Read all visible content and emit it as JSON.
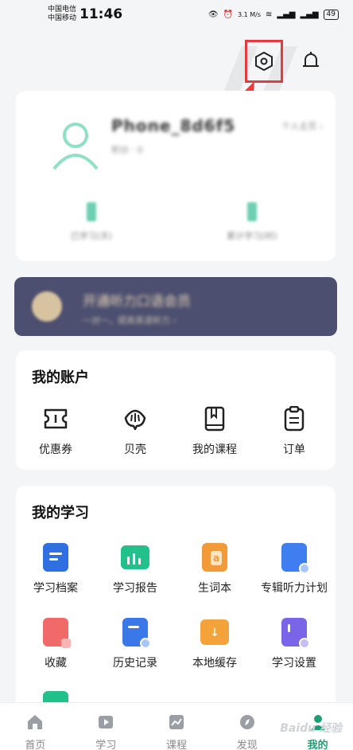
{
  "status_bar": {
    "carrier1": "中国电信",
    "carrier2": "中国移动",
    "time": "11:46",
    "speed": "3.1 M/s",
    "battery": "49"
  },
  "profile": {
    "username": "Phone_8d6f5",
    "subtitle": "积分 · 0",
    "tag": "个人主页 ›",
    "stats": [
      {
        "label": "已学习(天)"
      },
      {
        "label": "累计学习(时)"
      }
    ]
  },
  "vip": {
    "title": "开通听力口语会员",
    "subtitle": "一对一，提高英语听力 ›"
  },
  "account": {
    "title": "我的账户",
    "items": [
      {
        "label": "优惠券",
        "icon": "coupon-icon"
      },
      {
        "label": "贝壳",
        "icon": "shell-icon"
      },
      {
        "label": "我的课程",
        "icon": "course-icon"
      },
      {
        "label": "订单",
        "icon": "order-icon"
      }
    ]
  },
  "study": {
    "title": "我的学习",
    "items": [
      {
        "label": "学习档案",
        "icon": "study-archive-icon",
        "color": "#2f6fe0"
      },
      {
        "label": "学习报告",
        "icon": "study-report-icon",
        "color": "#22c08a"
      },
      {
        "label": "生词本",
        "icon": "vocab-book-icon",
        "color": "#f29a38"
      },
      {
        "label": "专辑听力计划",
        "icon": "listening-plan-icon",
        "color": "#3e7ef0"
      },
      {
        "label": "收藏",
        "icon": "favorites-icon",
        "color": "#f06a6a"
      },
      {
        "label": "历史记录",
        "icon": "history-icon",
        "color": "#3a78ea"
      },
      {
        "label": "本地缓存",
        "icon": "local-cache-icon",
        "color": "#f4a23a"
      },
      {
        "label": "学习设置",
        "icon": "study-settings-icon",
        "color": "#7a64e8"
      }
    ]
  },
  "bottom_nav": {
    "items": [
      {
        "label": "首页",
        "icon": "home-icon"
      },
      {
        "label": "学习",
        "icon": "study-icon"
      },
      {
        "label": "课程",
        "icon": "course-tab-icon"
      },
      {
        "label": "发现",
        "icon": "discover-icon"
      },
      {
        "label": "我的",
        "icon": "me-icon"
      }
    ],
    "active_index": 4
  },
  "watermark": "Baidu 经验",
  "colors": {
    "accent": "#1f9e75",
    "highlight_box": "#e53b3b",
    "vip_bg": "#4c4f6f"
  }
}
